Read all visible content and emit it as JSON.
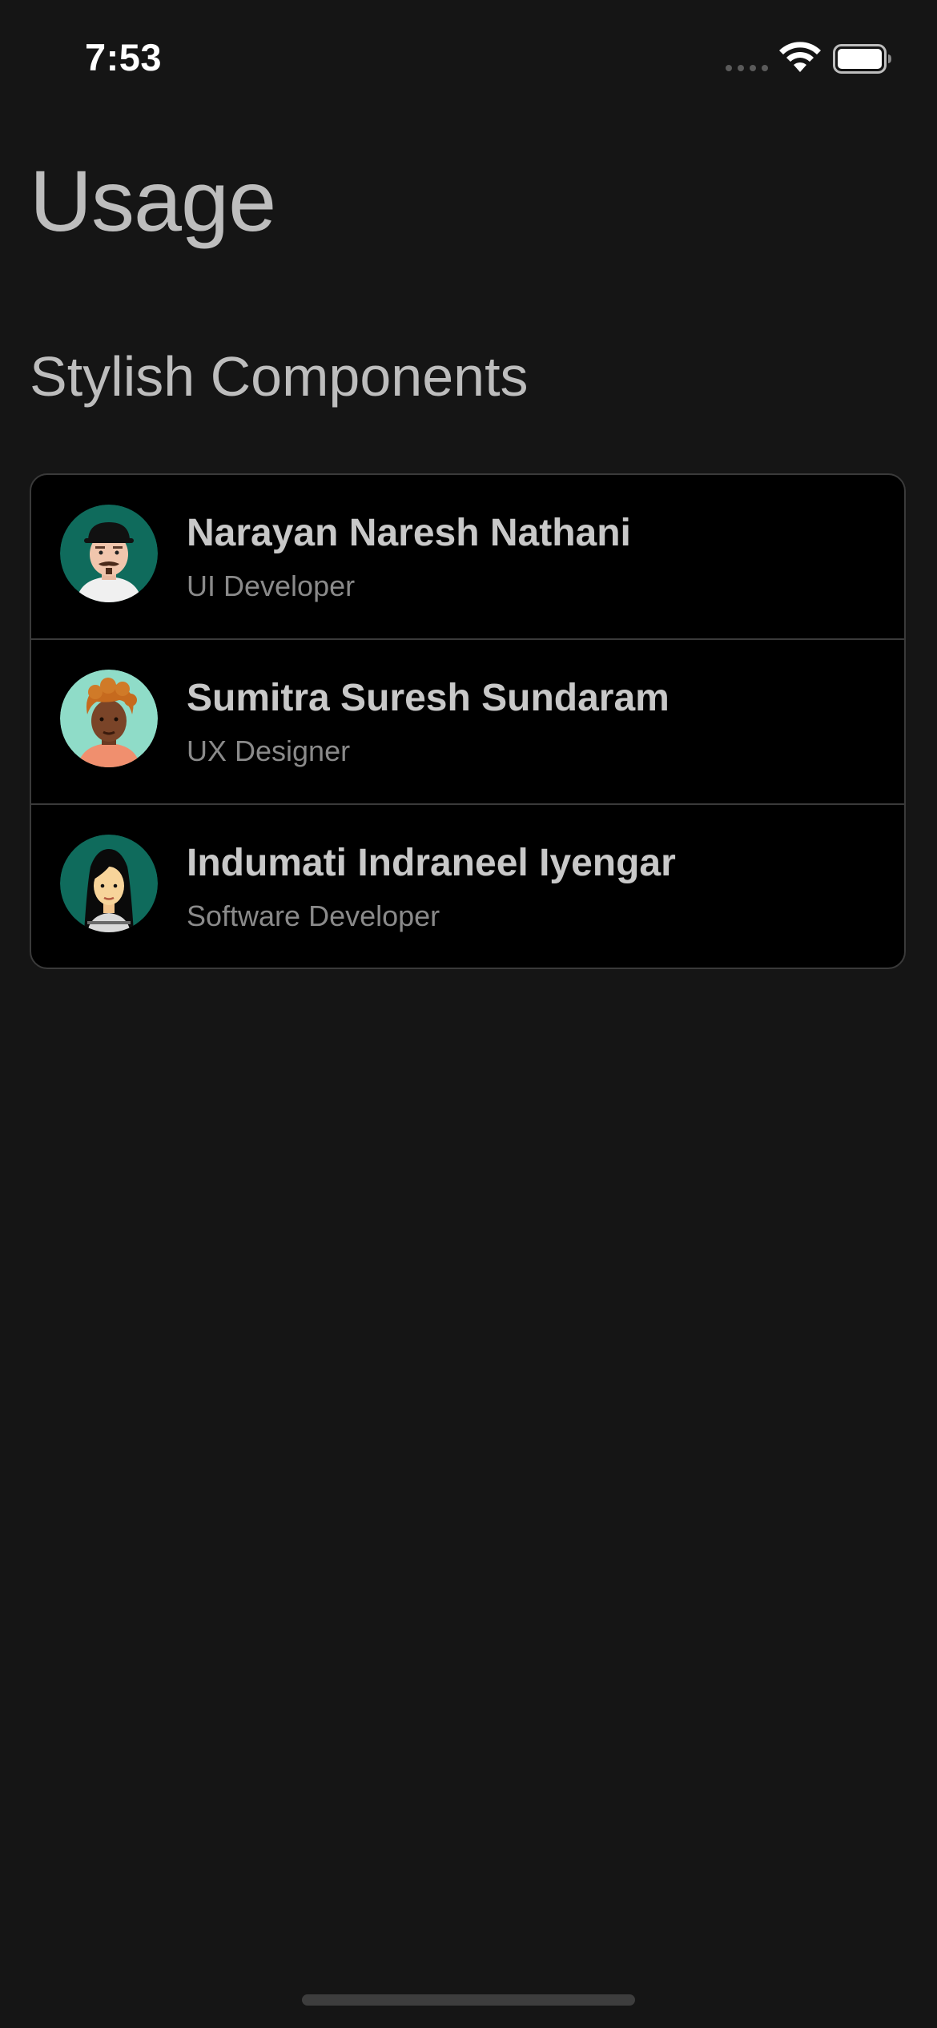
{
  "status_bar": {
    "time": "7:53"
  },
  "page": {
    "title": "Usage",
    "section_title": "Stylish Components"
  },
  "list": {
    "items": [
      {
        "name": "Narayan Naresh Nathani",
        "role": "UI Developer",
        "avatar_icon": "man-with-cap-avatar",
        "avatar_bg": "#0f6b5c"
      },
      {
        "name": "Sumitra Suresh Sundaram",
        "role": "UX Designer",
        "avatar_icon": "woman-curly-hair-avatar",
        "avatar_bg": "#8fdcc8"
      },
      {
        "name": "Indumati Indraneel Iyengar",
        "role": "Software Developer",
        "avatar_icon": "woman-black-hair-avatar",
        "avatar_bg": "#0f6b5c"
      }
    ]
  },
  "colors": {
    "background": "#151515",
    "card": "#000000",
    "divider": "#3a3a3a",
    "primary_text": "#c8c8c8",
    "secondary_text": "#8a8a8a"
  }
}
